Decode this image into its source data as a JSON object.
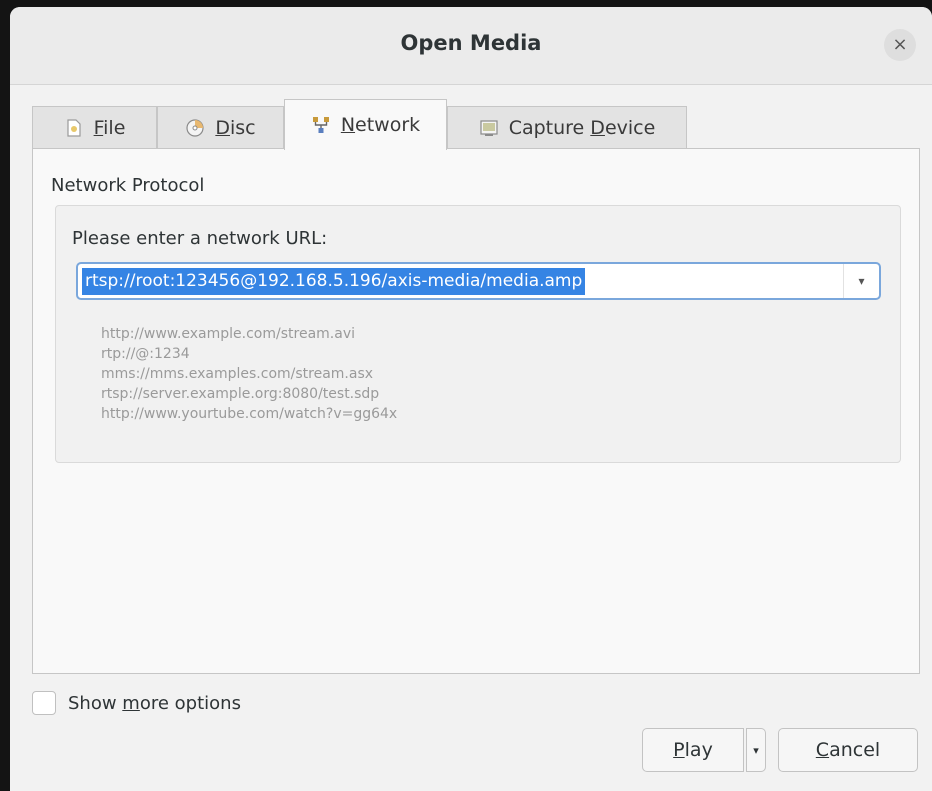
{
  "window": {
    "title": "Open Media",
    "close_icon": "×"
  },
  "tabs": [
    {
      "prefix": "",
      "mnemonic": "F",
      "rest": "ile",
      "icon": "file-icon"
    },
    {
      "prefix": "",
      "mnemonic": "D",
      "rest": "isc",
      "icon": "disc-icon"
    },
    {
      "prefix": "",
      "mnemonic": "N",
      "rest": "etwork",
      "icon": "network-icon",
      "active": true
    },
    {
      "prefix": "Capture ",
      "mnemonic": "D",
      "rest": "evice",
      "icon": "capture-device-icon"
    }
  ],
  "network": {
    "section_label": "Network Protocol",
    "url_label": "Please enter a network URL:",
    "url_value": "rtsp://root:123456@192.168.5.196/axis-media/media.amp",
    "dropdown_icon": "▾",
    "examples": [
      "http://www.example.com/stream.avi",
      "rtp://@:1234",
      "mms://mms.examples.com/stream.asx",
      "rtsp://server.example.org:8080/test.sdp",
      "http://www.yourtube.com/watch?v=gg64x"
    ]
  },
  "options": {
    "show_more_prefix": "Show ",
    "show_more_mnemonic": "m",
    "show_more_rest": "ore options",
    "checked": false
  },
  "buttons": {
    "play_mnemonic": "P",
    "play_rest": "lay",
    "play_dropdown": "▾",
    "cancel_mnemonic": "C",
    "cancel_rest": "ancel"
  },
  "colors": {
    "selection": "#3584e4",
    "focus_border": "#7aa7dc"
  }
}
